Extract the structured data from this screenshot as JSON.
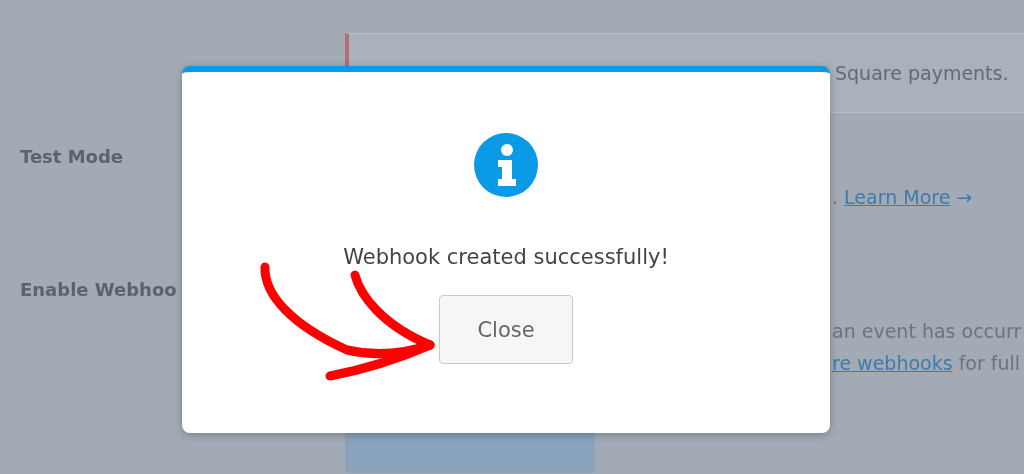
{
  "notice": {
    "text": "Square payments."
  },
  "settings": [
    {
      "label": "Test Mode",
      "lines": [
        [
          {
            "kind": "text",
            "text": "."
          },
          {
            "kind": "link",
            "text": "Learn More"
          },
          {
            "kind": "arrow",
            "text": "→"
          }
        ]
      ]
    },
    {
      "label": "Enable Webhoo",
      "lines": [
        [
          {
            "kind": "text",
            "text": "an event has occurr"
          }
        ],
        [
          {
            "kind": "link",
            "text": "re webhooks"
          },
          {
            "kind": "text",
            "text": "for full"
          }
        ]
      ]
    }
  ],
  "modal": {
    "message": "Webhook created successfully!",
    "button": "Close"
  }
}
